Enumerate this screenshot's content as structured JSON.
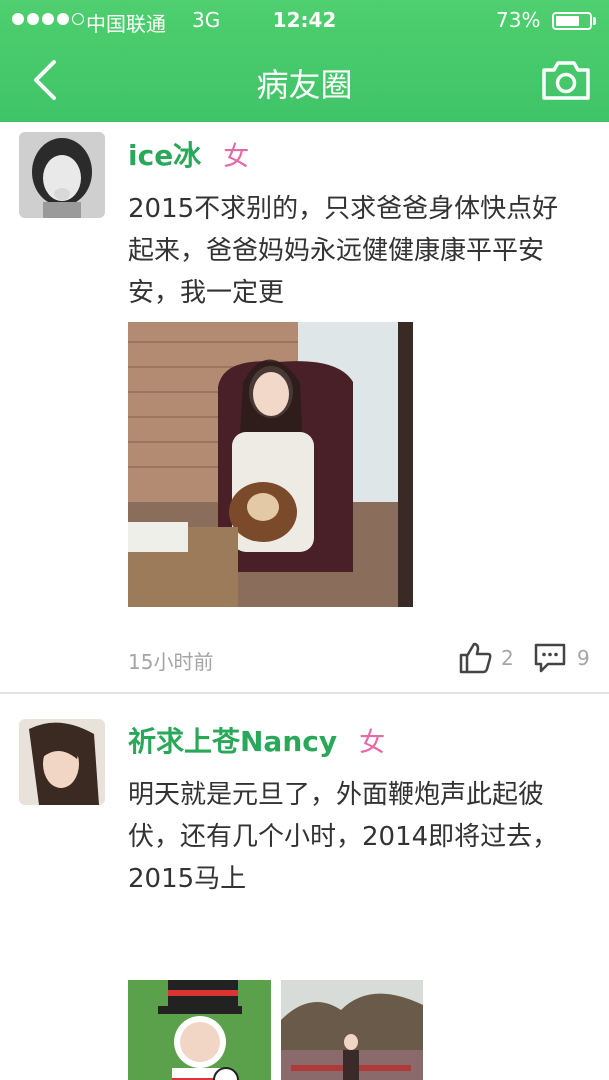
{
  "status_bar": {
    "carrier": "中国联通",
    "network": "3G",
    "time": "12:42",
    "battery_percent": "73%",
    "battery_level": 0.73
  },
  "nav": {
    "title": "病友圈",
    "back_icon": "chevron-left-icon",
    "camera_icon": "camera-icon"
  },
  "colors": {
    "header": "#43c66a",
    "username": "#29a85a",
    "gender": "#e66aa6",
    "meta": "#a5a5a5",
    "text": "#333333"
  },
  "posts": [
    {
      "username": "ice冰",
      "gender": "女",
      "text": "2015不求别的，只求爸爸身体快点好起来，爸爸妈妈永远健健康康平平安安，我一定更",
      "time": "15小时前",
      "likes": "2",
      "comments": "9"
    },
    {
      "username": "祈求上苍Nancy",
      "gender": "女",
      "text": "明天就是元旦了，外面鞭炮声此起彼伏，还有几个小时，2014即将过去，2015马上"
    }
  ]
}
